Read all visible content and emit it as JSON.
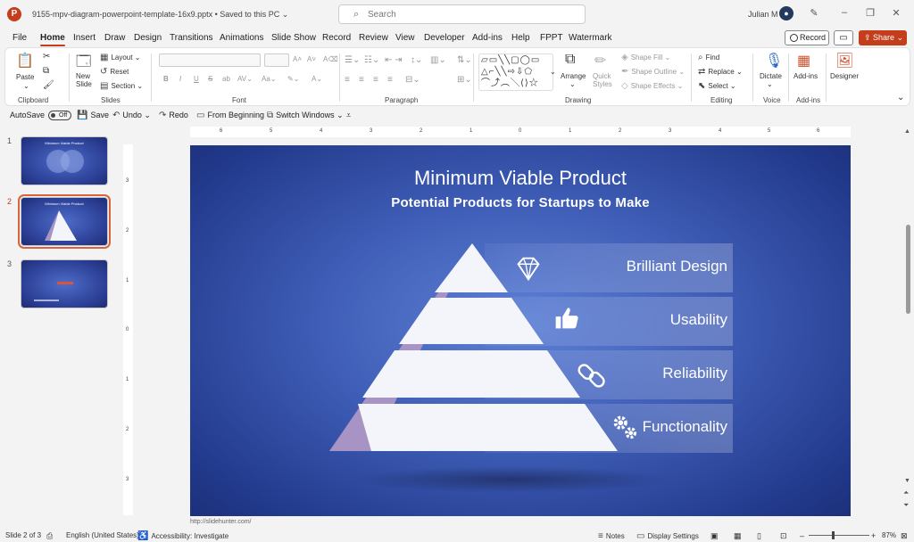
{
  "window": {
    "doc_title": "9155-mpv-diagram-powerpoint-template-16x9.pptx • Saved to this PC ⌄",
    "search_placeholder": "Search",
    "user_name": "Julian M"
  },
  "menu": {
    "tabs": [
      "File",
      "Home",
      "Insert",
      "Draw",
      "Design",
      "Transitions",
      "Animations",
      "Slide Show",
      "Record",
      "Review",
      "View",
      "Developer",
      "Add-ins",
      "Help",
      "FPPT",
      "Watermark"
    ],
    "active": "Home",
    "record_label": "Record",
    "share_label": "Share"
  },
  "ribbon": {
    "groups": [
      "Clipboard",
      "Slides",
      "Font",
      "Paragraph",
      "Drawing",
      "Editing",
      "Voice",
      "Add-ins"
    ],
    "paste": "Paste",
    "new_slide": "New Slide",
    "layout": "Layout",
    "reset": "Reset",
    "section": "Section",
    "arrange": "Arrange",
    "quick_styles": "Quick Styles",
    "shape_fill": "Shape Fill",
    "shape_outline": "Shape Outline",
    "shape_effects": "Shape Effects",
    "find": "Find",
    "replace": "Replace",
    "select": "Select",
    "dictate": "Dictate",
    "addins": "Add-ins",
    "designer": "Designer"
  },
  "qat": {
    "autosave": "AutoSave",
    "autosave_state": "Off",
    "save": "Save",
    "undo": "Undo",
    "redo": "Redo",
    "from_beginning": "From Beginning",
    "switch_windows": "Switch Windows"
  },
  "thumbnails": [
    {
      "number": "1",
      "title": "Minimum Viable Product",
      "selected": false
    },
    {
      "number": "2",
      "title": "Minimum Viable Product",
      "selected": true
    },
    {
      "number": "3",
      "title": "",
      "selected": false
    }
  ],
  "rulers": {
    "horizontal": [
      "6",
      "5",
      "4",
      "3",
      "2",
      "1",
      "0",
      "1",
      "2",
      "3",
      "4",
      "5",
      "6"
    ],
    "vertical": [
      "3",
      "2",
      "1",
      "0",
      "1",
      "2",
      "3"
    ]
  },
  "slide": {
    "title": "Minimum Viable Product",
    "subtitle": "Potential Products for Startups to Make",
    "levels": [
      {
        "label": "Brilliant Design",
        "icon": "diamond-icon"
      },
      {
        "label": "Usability",
        "icon": "thumbs-up-icon"
      },
      {
        "label": "Reliability",
        "icon": "chain-link-icon"
      },
      {
        "label": "Functionality",
        "icon": "gears-icon"
      }
    ],
    "colors": {
      "background": "#3e5cb5",
      "pyramid": "#f4f5fa",
      "pyramid_side": "#a794c4"
    }
  },
  "footer_link": "http://slidehunter.com/",
  "status": {
    "slide_info": "Slide 2 of 3",
    "language": "English (United States)",
    "accessibility": "Accessibility: Investigate",
    "notes": "Notes",
    "display_settings": "Display Settings",
    "zoom": "87%"
  }
}
